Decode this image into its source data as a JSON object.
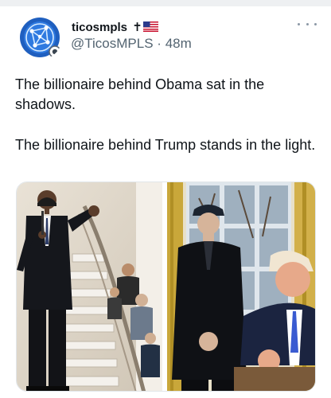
{
  "post": {
    "display_name": "ticosmpls",
    "name_badge": "✝",
    "handle": "@TicosMPLS",
    "separator": "·",
    "time_ago": "48m",
    "paragraphs": [
      "The billionaire behind Obama sat in the shadows.",
      "The billionaire behind Trump stands in the light."
    ]
  },
  "icons": {
    "more": "more-horizontal-icon",
    "flag": "us-flag-icon",
    "cross": "cross-icon"
  },
  "colors": {
    "text_primary": "#0f1419",
    "text_secondary": "#536471",
    "avatar_blue": "#1f5fbf"
  }
}
